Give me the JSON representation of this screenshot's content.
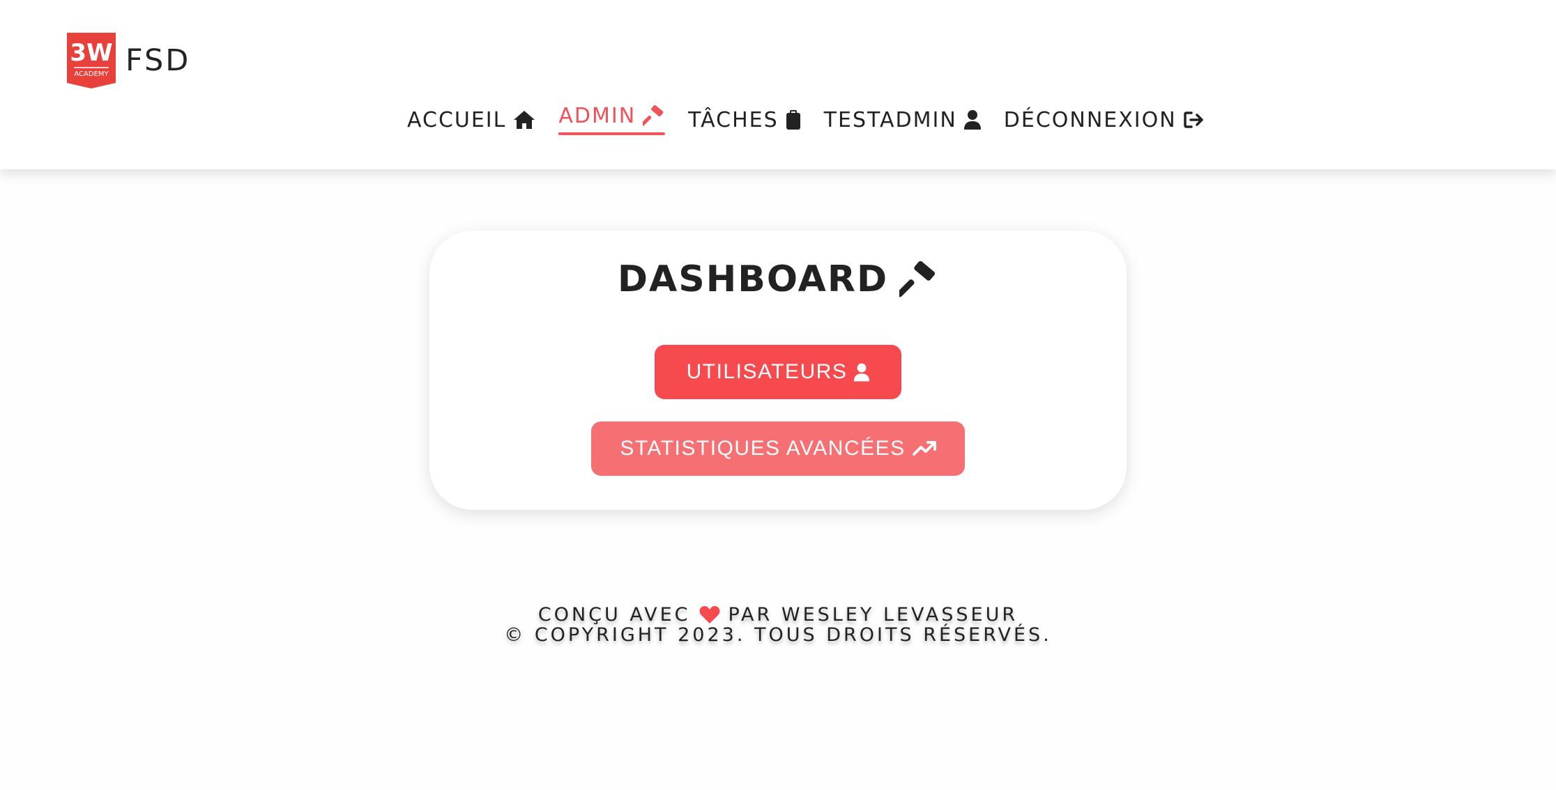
{
  "brand": {
    "logo_text_top": "3W",
    "logo_text_bottom": "ACADEMY",
    "name": "FSD"
  },
  "nav": {
    "items": [
      {
        "label": "ACCUEIL",
        "icon": "home-icon"
      },
      {
        "label": "ADMIN",
        "icon": "hammer-icon",
        "active": true
      },
      {
        "label": "TÂCHES",
        "icon": "clipboard-icon"
      },
      {
        "label": "TESTADMIN",
        "icon": "user-icon"
      },
      {
        "label": "DÉCONNEXION",
        "icon": "logout-icon"
      }
    ]
  },
  "dashboard": {
    "title": "DASHBOARD",
    "title_icon": "hammer-icon",
    "users_button": "UTILISATEURS",
    "stats_button": "STATISTIQUES AVANCÉES"
  },
  "footer": {
    "line1_before": "CONÇU AVEC",
    "line1_after": "PAR WESLEY LEVASSEUR",
    "line2": "© COPYRIGHT 2023. TOUS DROITS RÉSERVÉS."
  },
  "colors": {
    "accent": "#f05258",
    "primary_button": "#f64a4f",
    "secondary_button": "#f56f73",
    "logo_red": "#e8403a",
    "text": "#222222"
  }
}
